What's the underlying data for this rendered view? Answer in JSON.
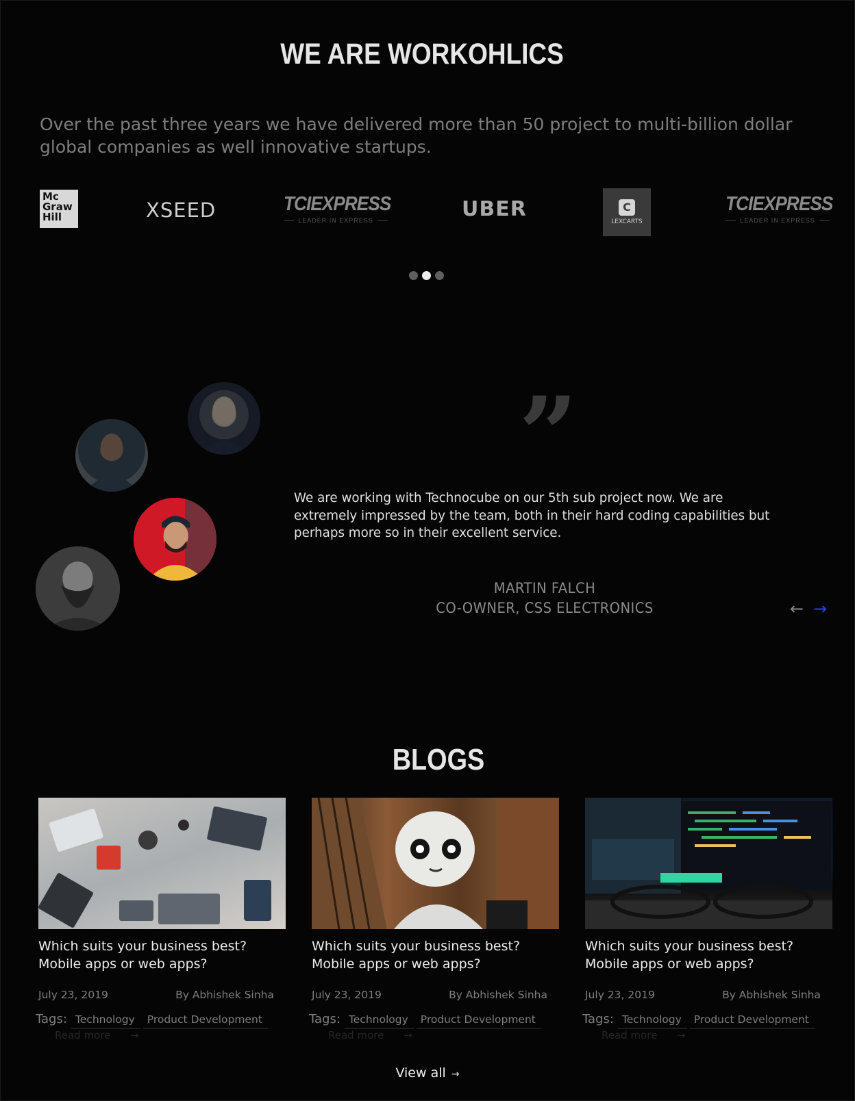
{
  "about": {
    "heading": "WE ARE WORKOHLICS",
    "intro": "Over the past three years we have delivered more than 50 project to multi-billion dollar global companies as well innovative startups."
  },
  "clients": {
    "logos": [
      {
        "name": "Mc Graw Hill",
        "lines": [
          "Mc",
          "Graw",
          "Hill"
        ]
      },
      {
        "name": "XSEED",
        "text": "XSEED"
      },
      {
        "name": "TCI Express",
        "text": "TCIEXPRESS",
        "subtext": "LEADER IN EXPRESS"
      },
      {
        "name": "Uber",
        "text": "UBER"
      },
      {
        "name": "Lexcarts",
        "mark": "C",
        "text": "LEXCARTS"
      },
      {
        "name": "TCI Express",
        "text": "TCIEXPRESS",
        "subtext": "LEADER IN EXPRESS"
      }
    ],
    "carousel": {
      "pages": 3,
      "active_index": 1
    }
  },
  "testimonial": {
    "quote_mark": "”",
    "text": "We are working with  Technocube on our 5th sub  project  now. We are extremely impressed by the team, both in their hard coding capabilities but perhaps more so in their excellent service.",
    "name": "MARTIN FALCH",
    "role": "CO-OWNER, CSS ELECTRONICS",
    "prev_icon": "arrow-left-icon",
    "next_icon": "arrow-right-icon",
    "accent_color": "#2d3bf0"
  },
  "blogs": {
    "heading": "BLOGS",
    "posts": [
      {
        "title": "Which suits your business best? Mobile apps or web apps?",
        "date": "July 23, 2019",
        "author": "By Abhishek Sinha",
        "tags_label": "Tags:",
        "tags": [
          "Technology",
          "Product Development"
        ],
        "read_more": "Read more",
        "image": "team-working-on-laptops-photo"
      },
      {
        "title": "Which suits your business best? Mobile apps or web apps?",
        "date": "July 23, 2019",
        "author": "By Abhishek Sinha",
        "tags_label": "Tags:",
        "tags": [
          "Technology",
          "Product Development"
        ],
        "read_more": "Read more",
        "image": "white-robot-photo"
      },
      {
        "title": "Which suits your business best? Mobile apps or web apps?",
        "date": "July 23, 2019",
        "author": "By Abhishek Sinha",
        "tags_label": "Tags:",
        "tags": [
          "Technology",
          "Product Development"
        ],
        "read_more": "Read more",
        "image": "code-screen-with-glasses-photo"
      }
    ],
    "view_all": "View all",
    "view_all_arrow": "→"
  }
}
